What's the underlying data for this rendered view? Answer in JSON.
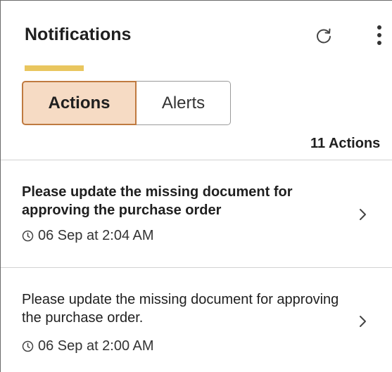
{
  "header": {
    "title": "Notifications",
    "refresh_icon": "refresh-icon",
    "menu_icon": "more-vertical-icon"
  },
  "tabs": [
    {
      "label": "Actions",
      "selected": true
    },
    {
      "label": "Alerts",
      "selected": false
    }
  ],
  "count_label": "11 Actions",
  "notifications": [
    {
      "text": "Please update the missing document for approving the purchase order",
      "time": "06 Sep at 2:04 AM",
      "unread": true
    },
    {
      "text": "Please update the missing document for approving the purchase order.",
      "time": "06 Sep at 2:00 AM",
      "unread": false
    }
  ],
  "colors": {
    "accent": "#e9c65f",
    "selected_tab_bg": "#f6dbc4",
    "selected_tab_border": "#bf7a40"
  }
}
